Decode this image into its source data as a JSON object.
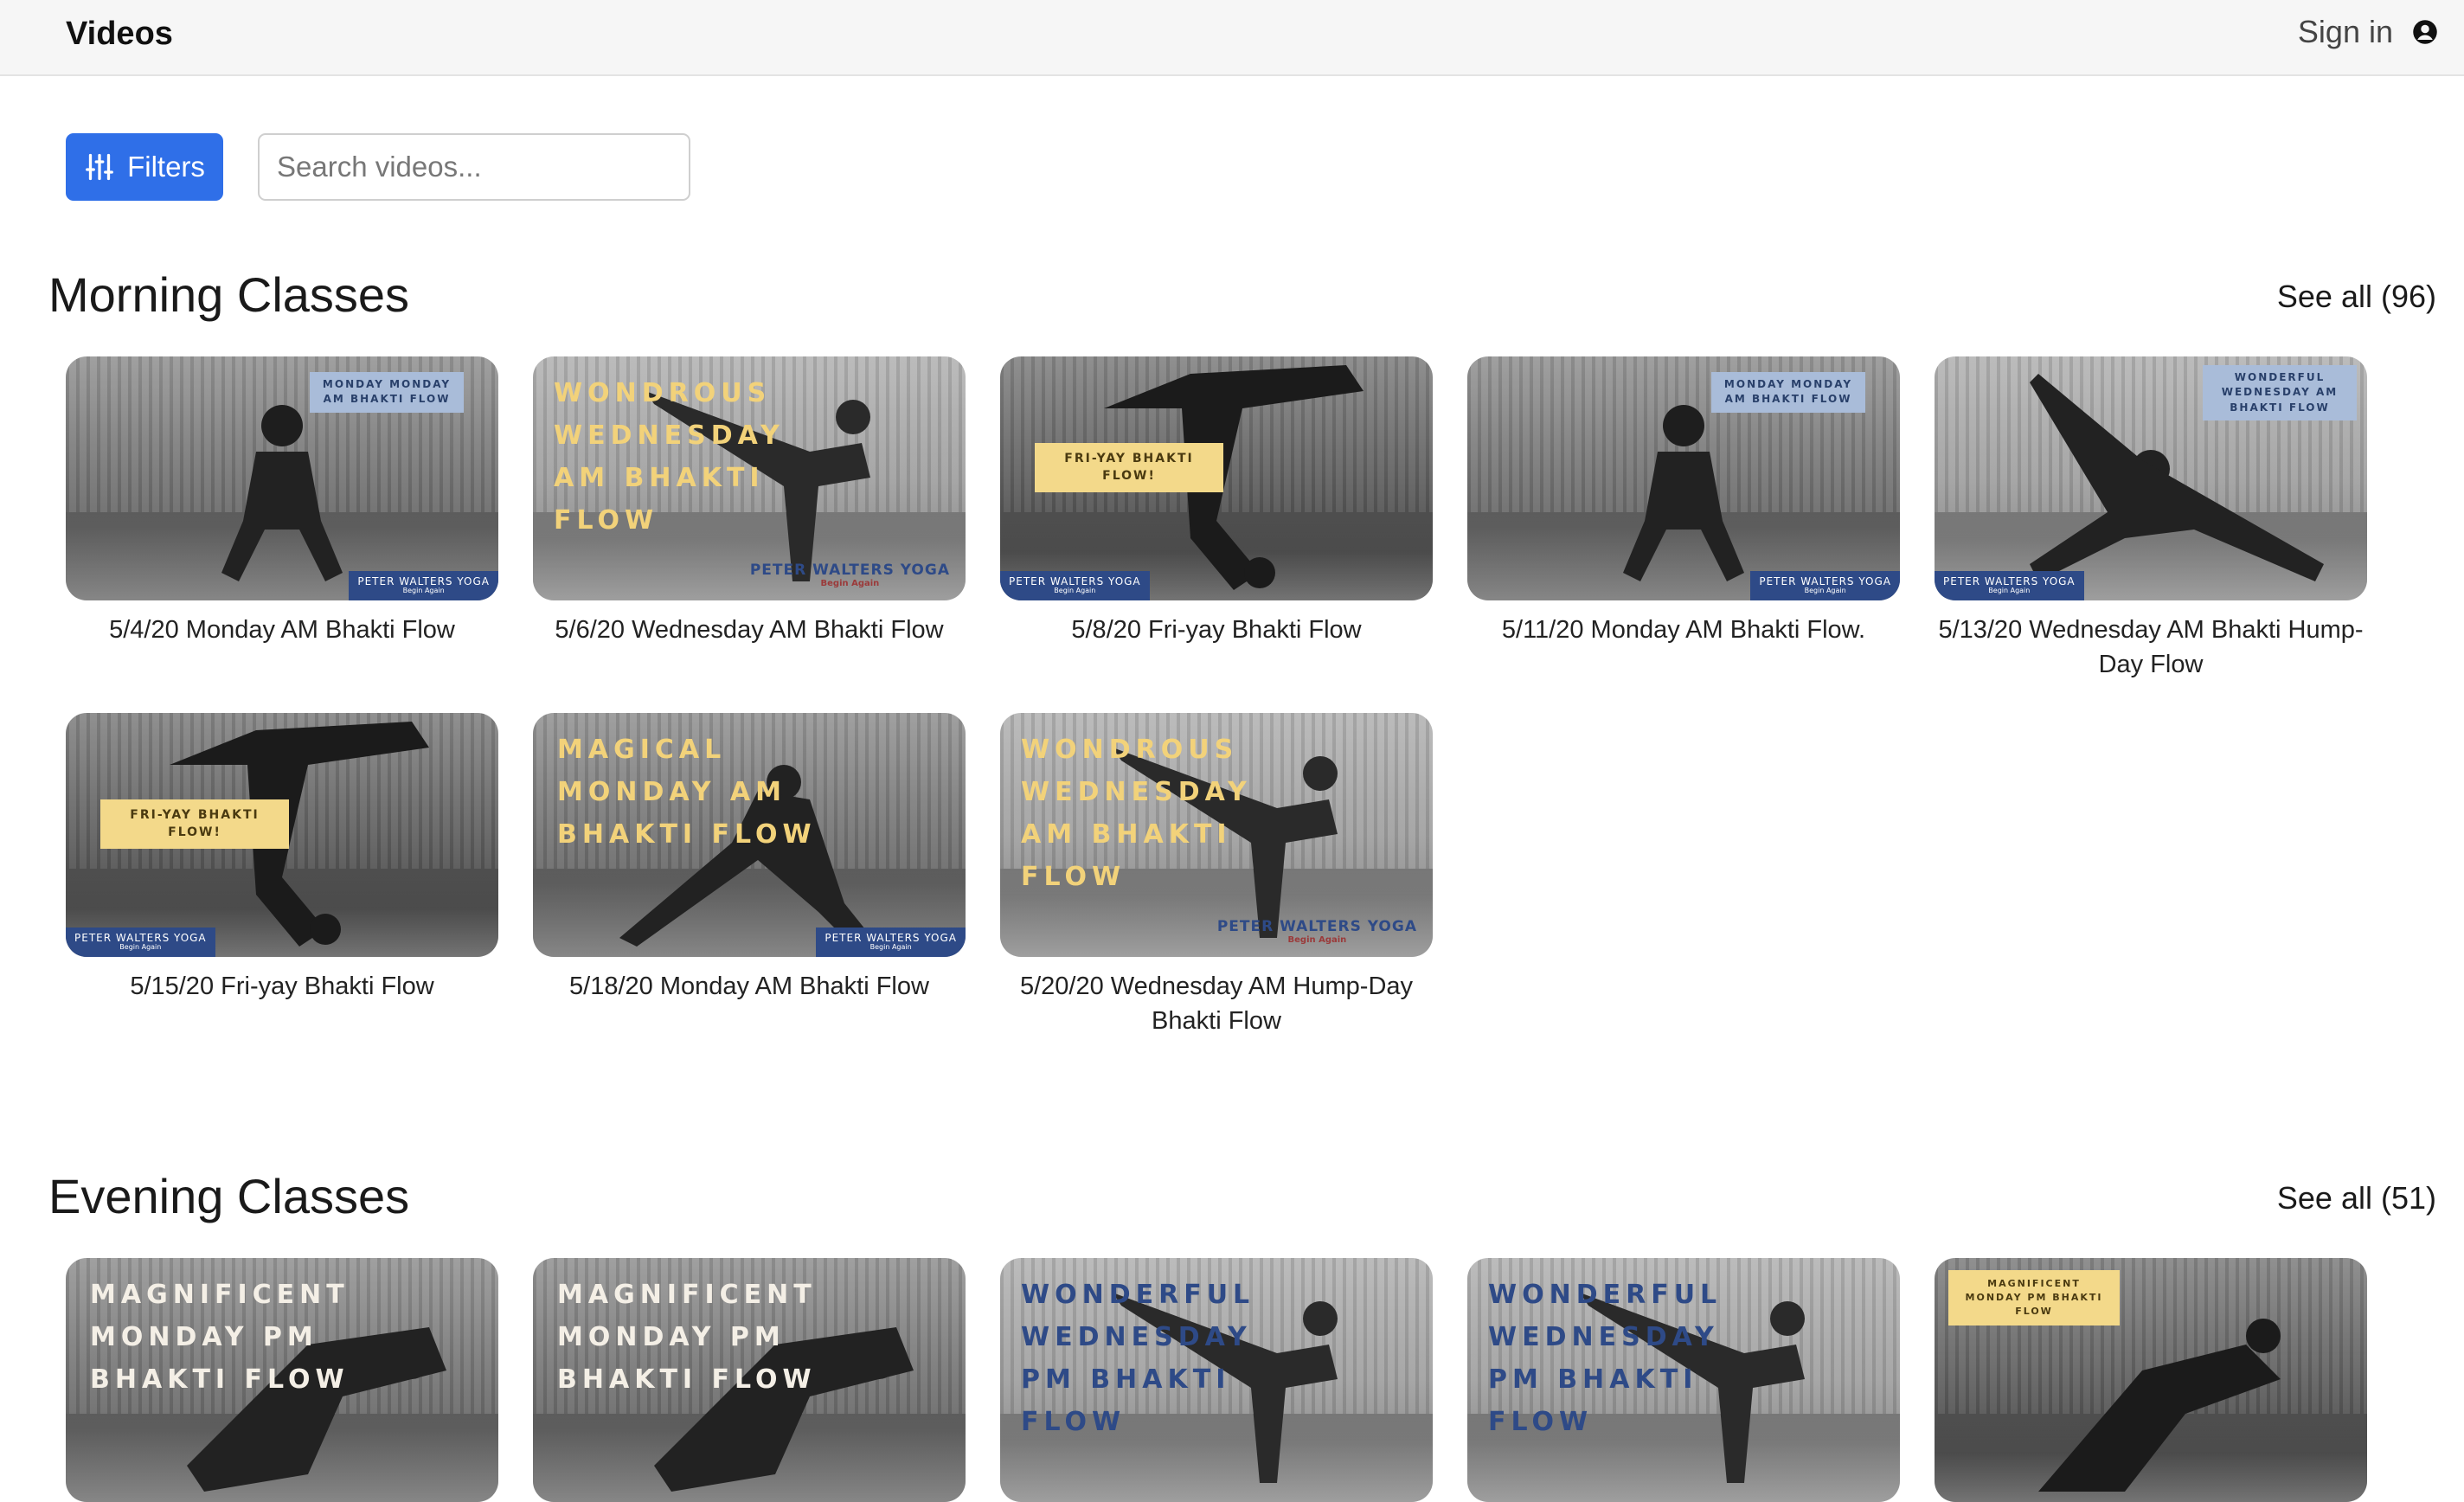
{
  "header": {
    "title": "Videos",
    "signin_label": "Sign in",
    "signin_icon": "user-circle-icon"
  },
  "controls": {
    "filters_label": "Filters",
    "filters_icon": "sliders-icon",
    "search_placeholder": "Search videos..."
  },
  "colors": {
    "accent": "#2f6fe8",
    "brand_blue": "#2e4a87",
    "badge_blue": "#a9bcd9",
    "badge_yellow": "#f3d98a",
    "text_yellow": "#f2d27a"
  },
  "sections": [
    {
      "title": "Morning Classes",
      "see_all": "See all (96)",
      "videos": [
        {
          "caption": "5/4/20 Monday AM Bhakti Flow",
          "badge": "MONDAY MONDAY AM BHAKTI FLOW",
          "brand": "PETER WALTERS YOGA",
          "brand_sub": "Begin Again"
        },
        {
          "caption": "5/6/20 Wednesday AM Bhakti Flow",
          "overlay": "WONDROUS\nWEDNESDAY\nAM BHAKTI\nFLOW",
          "brand": "PETER WALTERS YOGA",
          "brand_sub": "Begin Again"
        },
        {
          "caption": "5/8/20 Fri-yay Bhakti Flow",
          "badge": "FRI-YAY BHAKTI FLOW!",
          "brand": "PETER WALTERS YOGA",
          "brand_sub": "Begin Again"
        },
        {
          "caption": "5/11/20 Monday AM Bhakti Flow.",
          "badge": "MONDAY MONDAY AM BHAKTI FLOW",
          "brand": "PETER WALTERS YOGA",
          "brand_sub": "Begin Again"
        },
        {
          "caption": "5/13/20 Wednesday AM Bhakti Hump-Day Flow",
          "badge": "WONDERFUL WEDNESDAY AM BHAKTI FLOW",
          "brand": "PETER WALTERS YOGA",
          "brand_sub": "Begin Again"
        },
        {
          "caption": "5/15/20 Fri-yay Bhakti Flow",
          "badge": "FRI-YAY BHAKTI FLOW!",
          "brand": "PETER WALTERS YOGA",
          "brand_sub": "Begin Again"
        },
        {
          "caption": "5/18/20 Monday AM Bhakti Flow",
          "overlay": "MAGICAL\nMONDAY AM\nBHAKTI FLOW",
          "brand": "PETER WALTERS YOGA",
          "brand_sub": "Begin Again"
        },
        {
          "caption": "5/20/20 Wednesday AM Hump-Day Bhakti Flow",
          "overlay": "WONDROUS\nWEDNESDAY\nAM BHAKTI\nFLOW",
          "brand": "PETER WALTERS YOGA",
          "brand_sub": "Begin Again"
        }
      ]
    },
    {
      "title": "Evening Classes",
      "see_all": "See all (51)",
      "videos": [
        {
          "overlay": "MAGNIFICENT\nMONDAY PM\nBHAKTI FLOW"
        },
        {
          "overlay": "MAGNIFICENT\nMONDAY PM\nBHAKTI FLOW"
        },
        {
          "overlay": "WONDERFUL\nWEDNESDAY\nPM BHAKTI\nFLOW"
        },
        {
          "overlay": "WONDERFUL\nWEDNESDAY\nPM BHAKTI\nFLOW"
        },
        {
          "badge": "MAGNIFICENT MONDAY PM BHAKTI FLOW"
        }
      ]
    }
  ]
}
